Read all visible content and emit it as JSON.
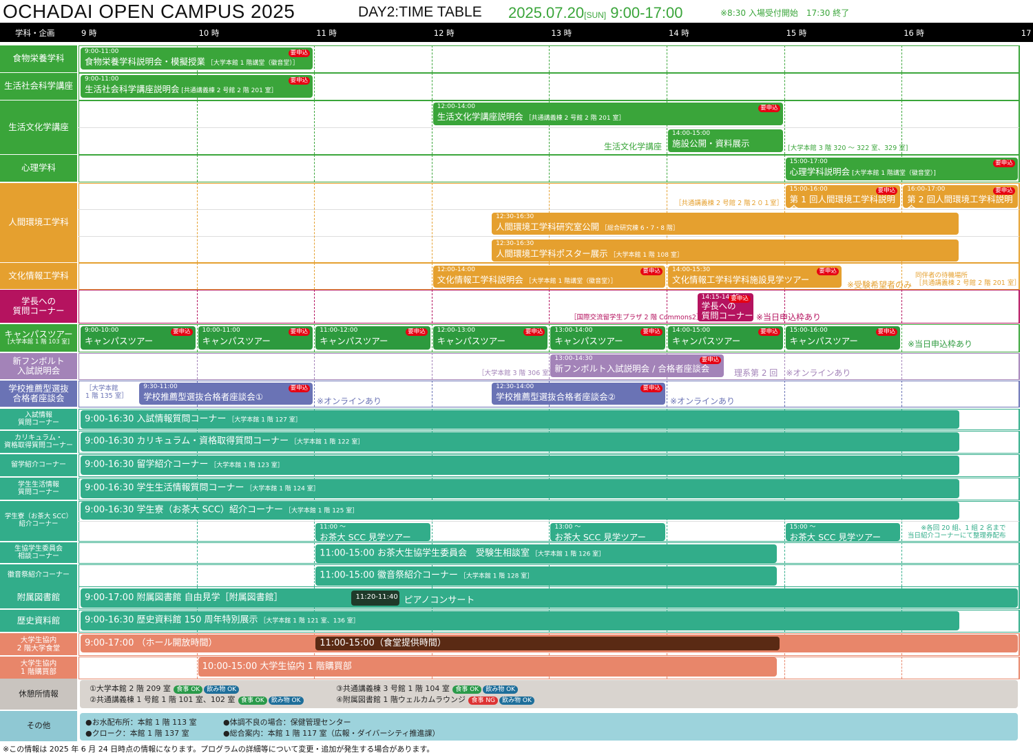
{
  "header": {
    "title": "OCHADAI OPEN CAMPUS 2025",
    "day": "DAY2:TIME TABLE",
    "date": "2025.07.20",
    "weekday": "[SUN]",
    "hours": "9:00-17:00",
    "reception": "※8:30 入場受付開始　17:30 終了"
  },
  "timebar": {
    "label": "学科・企画",
    "hours": [
      "9 時",
      "10 時",
      "11 時",
      "12 時",
      "13 時",
      "14 時",
      "15 時",
      "16 時",
      "17 時"
    ]
  },
  "required_label": "要申込",
  "departments": [
    {
      "name": "食物栄養学科"
    },
    {
      "name": "生活社会科学講座"
    },
    {
      "name": "生活文化学講座"
    },
    {
      "name": "心理学科"
    },
    {
      "name": "人間環境工学科"
    },
    {
      "name": "文化情報工学科"
    },
    {
      "name": "学長への\n質問コーナー"
    },
    {
      "name": "キャンパスツアー",
      "sub": "[大学本館 1 階 103 室]"
    },
    {
      "name": "新フンボルト\n入試説明会"
    },
    {
      "name": "学校推薦型選抜\n合格者座談会"
    },
    {
      "name": "入試情報\n質問コーナー"
    },
    {
      "name": "カリキュラム・\n資格取得質問コーナー"
    },
    {
      "name": "留学紹介コーナー"
    },
    {
      "name": "学生生活情報\n質問コーナー"
    },
    {
      "name": "学生寮（お茶大 SCC）\n紹介コーナー"
    },
    {
      "name": "生協学生委員会\n相談コーナー"
    },
    {
      "name": "徽音祭紹介コーナー"
    },
    {
      "name": "附属図書館"
    },
    {
      "name": "歴史資料館"
    },
    {
      "name": "大学生協内\n2 階大学食堂"
    },
    {
      "name": "大学生協内\n1 階購買部"
    },
    {
      "name": "休憩所情報"
    },
    {
      "name": "その他"
    }
  ],
  "events": [
    {
      "time": "9:00-11:00",
      "name": "食物栄養学科説明会・模擬授業",
      "room": "［大学本館 1 階講堂（徽音堂）］"
    },
    {
      "time": "9:00-11:00",
      "name": "生活社会科学講座説明会",
      "room": "[共通講義棟 2 号館 2 階 201 室］"
    },
    {
      "time": "12:00-14:00",
      "name": "生活文化学講座説明会",
      "room": "［共通講義棟 2 号館 2 階 201 室］"
    },
    {
      "time": "14:00-15:00",
      "name": "施設公開・資料展示",
      "room": ""
    },
    {
      "time": "15:00-17:00",
      "name": "心理学科説明会",
      "room": "[大学本館 1 階講堂（徽音堂）]"
    },
    {
      "time": "15:00-16:00",
      "name": "第 1 回人間環境工学科説明会",
      "room": ""
    },
    {
      "time": "16:00-17:00",
      "name": "第 2 回人間環境工学科説明会",
      "room": ""
    },
    {
      "time": "12:30-16:30",
      "name": "人間環境工学科研究室公開",
      "room": "［総合研究棟 6・7・8 階］"
    },
    {
      "time": "12:30-16:30",
      "name": "人間環境工学科ポスター展示",
      "room": "［大学本館 1 階 108 室］"
    },
    {
      "time": "12:00-14:00",
      "name": "文化情報工学科説明会",
      "room": "［大学本館 1 階講堂（徽音堂）］"
    },
    {
      "time": "14:00-15:30",
      "name": "文化情報工学科学科施設見学ツアー",
      "room": ""
    },
    {
      "time": "14:15-14:45",
      "name": "学長への\n質問コーナー",
      "room": ""
    },
    {
      "time": "9:00-10:00",
      "name": "キャンパスツアー"
    },
    {
      "time": "10:00-11:00",
      "name": "キャンパスツアー"
    },
    {
      "time": "11:00-12:00",
      "name": "キャンパスツアー"
    },
    {
      "time": "12:00-13:00",
      "name": "キャンパスツアー"
    },
    {
      "time": "13:00-14:00",
      "name": "キャンパスツアー"
    },
    {
      "time": "14:00-15:00",
      "name": "キャンパスツアー"
    },
    {
      "time": "15:00-16:00",
      "name": "キャンパスツアー"
    },
    {
      "time": "13:00-14:30",
      "name": "新フンボルト入試説明会 / 合格者座談会"
    },
    {
      "time": "9:30-11:00",
      "name": "学校推薦型選抜合格者座談会①"
    },
    {
      "time": "12:30-14:00",
      "name": "学校推薦型選抜合格者座談会②"
    },
    {
      "time": "9:00-16:30",
      "name": "入試情報質問コーナー",
      "room": "［大学本館 1 階 127 室］"
    },
    {
      "time": "9:00-16:30",
      "name": "カリキュラム・資格取得質問コーナー",
      "room": "［大学本館 1 階 122 室］"
    },
    {
      "time": "9:00-16:30",
      "name": "留学紹介コーナー",
      "room": "［大学本館 1 階 123 室］"
    },
    {
      "time": "9:00-16:30",
      "name": "学生生活情報質問コーナー",
      "room": "［大学本館 1 階 124 室］"
    },
    {
      "time": "9:00-16:30",
      "name": "学生寮（お茶大 SCC）紹介コーナー",
      "room": "［大学本館 1 階 125 室］"
    },
    {
      "time": "11:00 ～",
      "name": "お茶大 SCC 見学ツアー"
    },
    {
      "time": "13:00 ～",
      "name": "お茶大 SCC 見学ツアー"
    },
    {
      "time": "15:00 ～",
      "name": "お茶大 SCC 見学ツアー"
    },
    {
      "time": "11:00-15:00",
      "name": "お茶大生協学生委員会　受験生相談室",
      "room": "［大学本館 1 階 126 室］"
    },
    {
      "time": "11:00-15:00",
      "name": "徽音祭紹介コーナー",
      "room": "［大学本館 1 階 128 室］"
    },
    {
      "time": "9:00-17:00",
      "name": "附属図書館 自由見学［附属図書館］",
      "room": ""
    },
    {
      "time": "11:20-11:40",
      "name": "ピアノコンサート",
      "room": ""
    },
    {
      "time": "9:00-16:30",
      "name": "歴史資料館 150 周年特別展示",
      "room": "［大学本館 1 階 121 室、136 室］"
    },
    {
      "time": "9:00-17:00",
      "name": "（ホール開放時間）",
      "room": ""
    },
    {
      "time": "11:00-15:00",
      "name": "（食堂提供時間）",
      "room": ""
    },
    {
      "time": "10:00-15:00",
      "name": "大学生協内 1 階購買部",
      "room": ""
    }
  ],
  "notes": {
    "seikatsu_bunka": "生活文化学講座",
    "seikatsu_bunka_room": "[大学本館 3 階 320 ～ 322 室、329 室]",
    "ningen_room": "［共通講義棟 2 号館 2 階２０１室］",
    "bunka_only": "※受験希望者のみ",
    "waiting": "同伴者の待機場所\n［共通講義棟 2 号館 2 階 201 室］",
    "gakucho_room": "［国際交流留学生プラザ 2 階 Commons2］",
    "gakucho_same_day": "※当日申込枠あり",
    "tour_same_day": "※当日申込枠あり",
    "humboldt_room": "［大学本館 3 階 306 室］",
    "humboldt_second": "理系第 2 回　※オンラインあり",
    "suisen_room": "［大学本館\n1 階 135 室］",
    "online1": "※オンラインあり",
    "online2": "※オンラインあり",
    "scc_note": "※各回 20 組、1 組 2 名まで\n当日紹介コーナーにて整理券配布"
  },
  "rest": {
    "items": [
      {
        "text": "①大学本館 2 階 209 室",
        "food": "食事 OK",
        "drink": "飲み物 OK"
      },
      {
        "text": "②共通講義棟 1 号館 1 階 101 室、102 室",
        "food": "食事 OK",
        "drink": "飲み物 OK"
      },
      {
        "text": "③共通講義棟 3 号館 1 階 104 室",
        "food": "食事 OK",
        "drink": "飲み物 OK"
      },
      {
        "text": "④附属図書館 1 階ウェルカムラウンジ",
        "food": "食事 NG",
        "drink": "飲み物 OK"
      }
    ]
  },
  "other": {
    "items": [
      "●お水配布所：本館 1 階 113 室",
      "●クローク：本館 1 階 137 室",
      "●体調不良の場合：保健管理センター",
      "●総合案内：本館 1 階 117 室（広報・ダイバーシティ推進課）"
    ]
  },
  "footer": "※この情報は 2025 年 6 月 24 日時点の情報になります。プログラムの詳細等について変更・追加が発生する場合があります。",
  "colors": {
    "green": "#3aa53a",
    "orange": "#e5a02f",
    "magenta": "#b5135f",
    "purple": "#a383b8",
    "indigo": "#6a73b5",
    "teal": "#32ad8a",
    "coral": "#e8866a",
    "dark": "#5a2a14",
    "grey": "#d9d4cf",
    "lightblue": "#9dd3dc"
  }
}
